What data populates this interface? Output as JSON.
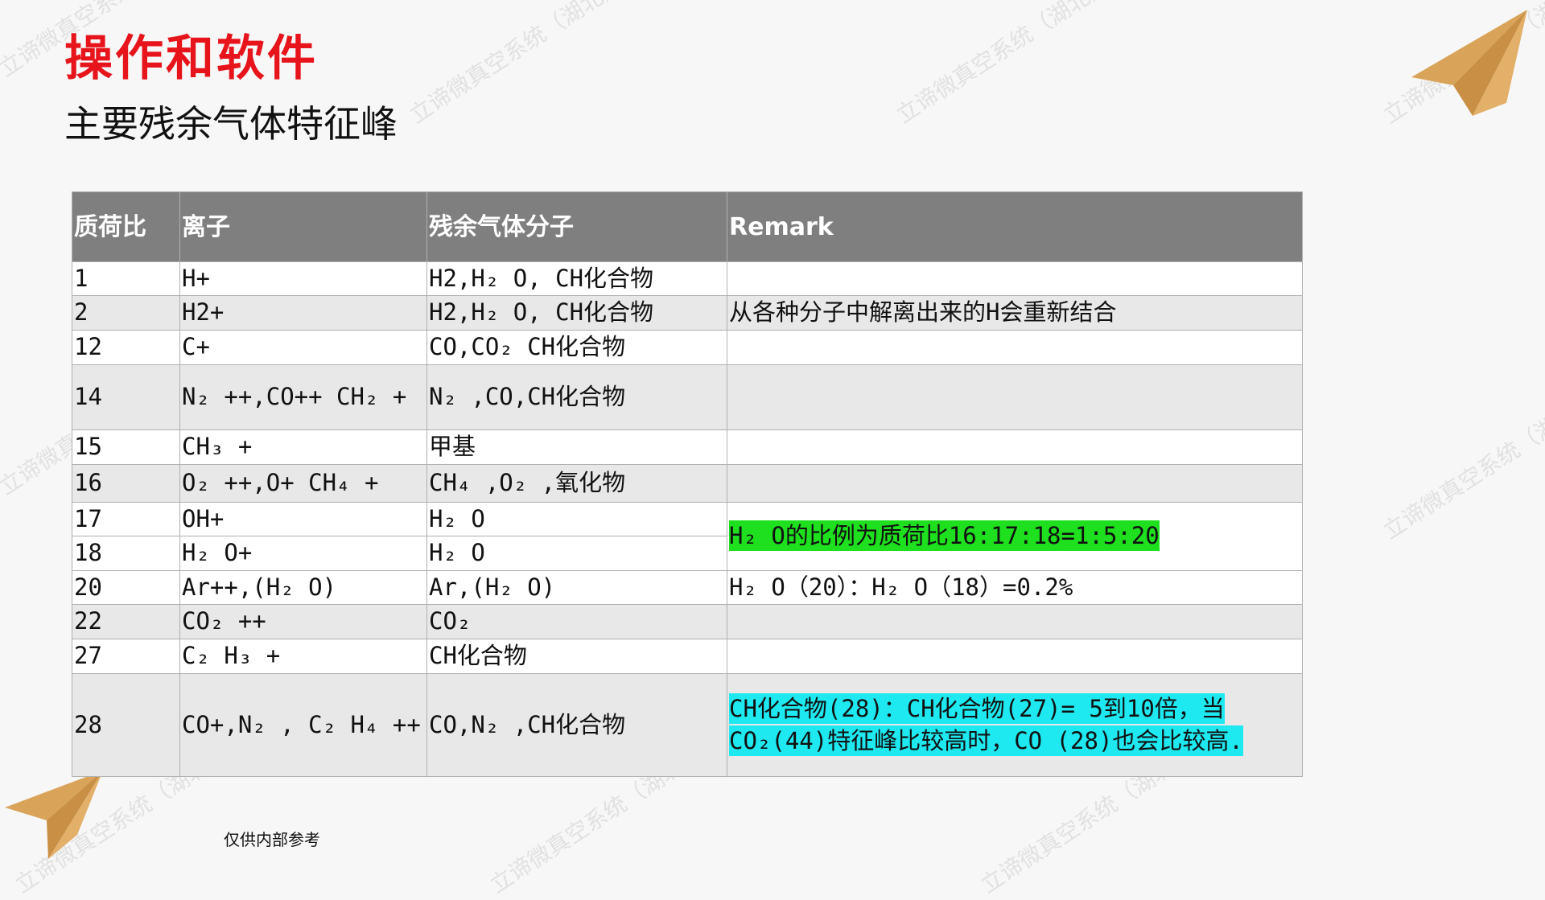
{
  "slide": {
    "title": "操作和软件",
    "subtitle": "主要残余气体特征峰",
    "footer": "仅供内部参考",
    "watermark": "立谛微真空系统（湖北）有限公司"
  },
  "colors": {
    "title": "#e8141b",
    "header_bg": "#7f7f7f",
    "highlight_green": "#1ee01e",
    "highlight_cyan": "#1ee8f0",
    "plane": "#d9a45a"
  },
  "icons": [
    "paper-plane-icon"
  ],
  "table": {
    "headers": [
      "质荷比",
      "离子",
      "残余气体分子",
      "Remark"
    ],
    "rows": [
      {
        "mz": "1",
        "ion": "H+",
        "molecule": "H2,H₂ O, CH化合物",
        "remark": ""
      },
      {
        "mz": "2",
        "ion": "H2+",
        "molecule": "H2,H₂ O, CH化合物",
        "remark": "从各种分子中解离出来的H会重新结合"
      },
      {
        "mz": "12",
        "ion": "C+",
        "molecule": "CO,CO₂  CH化合物",
        "remark": ""
      },
      {
        "mz": "14",
        "ion": "N₂ ++,CO++ CH₂ +",
        "molecule": "N₂ ,CO,CH化合物",
        "remark": ""
      },
      {
        "mz": "15",
        "ion": "CH₃ +",
        "molecule": "甲基",
        "remark": ""
      },
      {
        "mz": "16",
        "ion": "O₂ ++,O+ CH₄ +",
        "molecule": "CH₄ ,O₂ ,氧化物",
        "remark": ""
      },
      {
        "mz": "17",
        "ion": "OH+",
        "molecule": "H₂ O",
        "remark": "H₂ O的比例为质荷比16:17:18=1:5:20"
      },
      {
        "mz": "18",
        "ion": "H₂ O+",
        "molecule": "H₂ O"
      },
      {
        "mz": "20",
        "ion": "Ar++,(H₂ O)",
        "molecule": "Ar,(H₂ O)",
        "remark": "H₂ O（20）：H₂ O（18）=0.2%"
      },
      {
        "mz": "22",
        "ion": "CO₂ ++",
        "molecule": "CO₂",
        "remark": ""
      },
      {
        "mz": "27",
        "ion": "C₂ H₃ +",
        "molecule": "CH化合物",
        "remark": ""
      },
      {
        "mz": "28",
        "ion": "CO+,N₂ , C₂ H₄ ++",
        "molecule": "CO,N₂ ,CH化合物",
        "remark": "CH化合物(28)：CH化合物(27)= 5到10倍，当CO₂(44)特征峰比较高时，CO (28)也会比较高."
      }
    ]
  }
}
